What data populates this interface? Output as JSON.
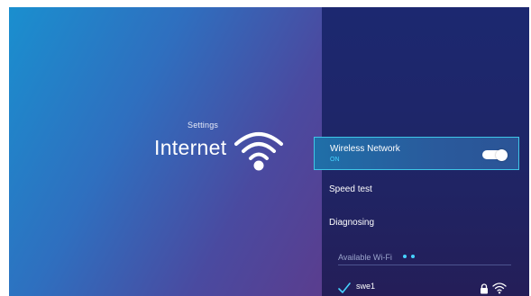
{
  "header": {
    "settings_label": "Settings",
    "title": "Internet",
    "icon": "wifi-icon"
  },
  "menu": {
    "items": [
      {
        "label": "Wireless Network",
        "sublabel": "ON",
        "selected": true,
        "toggle_on": true
      },
      {
        "label": "Speed test"
      },
      {
        "label": "Diagnosing"
      }
    ]
  },
  "available_wifi": {
    "label": "Available Wi-Fi",
    "networks": [
      {
        "name": "swe1",
        "connected": true,
        "secured": true,
        "icons": [
          "check-icon",
          "lock-icon",
          "wifi-signal-icon"
        ]
      }
    ]
  },
  "colors": {
    "accent": "#3fc7e8",
    "status_on": "#46d3ff",
    "panel_dark": "#1f2566"
  }
}
